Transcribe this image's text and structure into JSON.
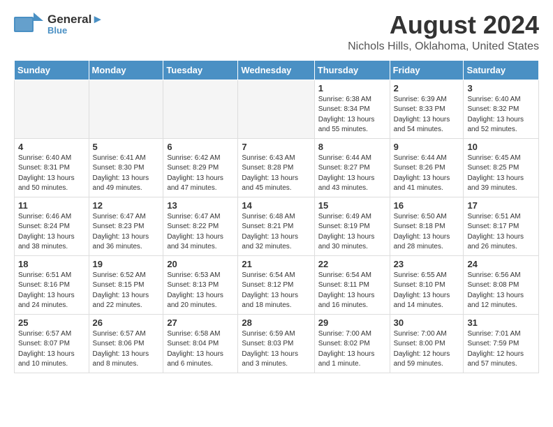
{
  "header": {
    "logo_general": "General",
    "logo_blue": "Blue",
    "month_title": "August 2024",
    "location": "Nichols Hills, Oklahoma, United States"
  },
  "weekdays": [
    "Sunday",
    "Monday",
    "Tuesday",
    "Wednesday",
    "Thursday",
    "Friday",
    "Saturday"
  ],
  "weeks": [
    [
      {
        "day": "",
        "sunrise": "",
        "sunset": "",
        "daylight": ""
      },
      {
        "day": "",
        "sunrise": "",
        "sunset": "",
        "daylight": ""
      },
      {
        "day": "",
        "sunrise": "",
        "sunset": "",
        "daylight": ""
      },
      {
        "day": "",
        "sunrise": "",
        "sunset": "",
        "daylight": ""
      },
      {
        "day": "1",
        "sunrise": "Sunrise: 6:38 AM",
        "sunset": "Sunset: 8:34 PM",
        "daylight": "Daylight: 13 hours and 55 minutes."
      },
      {
        "day": "2",
        "sunrise": "Sunrise: 6:39 AM",
        "sunset": "Sunset: 8:33 PM",
        "daylight": "Daylight: 13 hours and 54 minutes."
      },
      {
        "day": "3",
        "sunrise": "Sunrise: 6:40 AM",
        "sunset": "Sunset: 8:32 PM",
        "daylight": "Daylight: 13 hours and 52 minutes."
      }
    ],
    [
      {
        "day": "4",
        "sunrise": "Sunrise: 6:40 AM",
        "sunset": "Sunset: 8:31 PM",
        "daylight": "Daylight: 13 hours and 50 minutes."
      },
      {
        "day": "5",
        "sunrise": "Sunrise: 6:41 AM",
        "sunset": "Sunset: 8:30 PM",
        "daylight": "Daylight: 13 hours and 49 minutes."
      },
      {
        "day": "6",
        "sunrise": "Sunrise: 6:42 AM",
        "sunset": "Sunset: 8:29 PM",
        "daylight": "Daylight: 13 hours and 47 minutes."
      },
      {
        "day": "7",
        "sunrise": "Sunrise: 6:43 AM",
        "sunset": "Sunset: 8:28 PM",
        "daylight": "Daylight: 13 hours and 45 minutes."
      },
      {
        "day": "8",
        "sunrise": "Sunrise: 6:44 AM",
        "sunset": "Sunset: 8:27 PM",
        "daylight": "Daylight: 13 hours and 43 minutes."
      },
      {
        "day": "9",
        "sunrise": "Sunrise: 6:44 AM",
        "sunset": "Sunset: 8:26 PM",
        "daylight": "Daylight: 13 hours and 41 minutes."
      },
      {
        "day": "10",
        "sunrise": "Sunrise: 6:45 AM",
        "sunset": "Sunset: 8:25 PM",
        "daylight": "Daylight: 13 hours and 39 minutes."
      }
    ],
    [
      {
        "day": "11",
        "sunrise": "Sunrise: 6:46 AM",
        "sunset": "Sunset: 8:24 PM",
        "daylight": "Daylight: 13 hours and 38 minutes."
      },
      {
        "day": "12",
        "sunrise": "Sunrise: 6:47 AM",
        "sunset": "Sunset: 8:23 PM",
        "daylight": "Daylight: 13 hours and 36 minutes."
      },
      {
        "day": "13",
        "sunrise": "Sunrise: 6:47 AM",
        "sunset": "Sunset: 8:22 PM",
        "daylight": "Daylight: 13 hours and 34 minutes."
      },
      {
        "day": "14",
        "sunrise": "Sunrise: 6:48 AM",
        "sunset": "Sunset: 8:21 PM",
        "daylight": "Daylight: 13 hours and 32 minutes."
      },
      {
        "day": "15",
        "sunrise": "Sunrise: 6:49 AM",
        "sunset": "Sunset: 8:19 PM",
        "daylight": "Daylight: 13 hours and 30 minutes."
      },
      {
        "day": "16",
        "sunrise": "Sunrise: 6:50 AM",
        "sunset": "Sunset: 8:18 PM",
        "daylight": "Daylight: 13 hours and 28 minutes."
      },
      {
        "day": "17",
        "sunrise": "Sunrise: 6:51 AM",
        "sunset": "Sunset: 8:17 PM",
        "daylight": "Daylight: 13 hours and 26 minutes."
      }
    ],
    [
      {
        "day": "18",
        "sunrise": "Sunrise: 6:51 AM",
        "sunset": "Sunset: 8:16 PM",
        "daylight": "Daylight: 13 hours and 24 minutes."
      },
      {
        "day": "19",
        "sunrise": "Sunrise: 6:52 AM",
        "sunset": "Sunset: 8:15 PM",
        "daylight": "Daylight: 13 hours and 22 minutes."
      },
      {
        "day": "20",
        "sunrise": "Sunrise: 6:53 AM",
        "sunset": "Sunset: 8:13 PM",
        "daylight": "Daylight: 13 hours and 20 minutes."
      },
      {
        "day": "21",
        "sunrise": "Sunrise: 6:54 AM",
        "sunset": "Sunset: 8:12 PM",
        "daylight": "Daylight: 13 hours and 18 minutes."
      },
      {
        "day": "22",
        "sunrise": "Sunrise: 6:54 AM",
        "sunset": "Sunset: 8:11 PM",
        "daylight": "Daylight: 13 hours and 16 minutes."
      },
      {
        "day": "23",
        "sunrise": "Sunrise: 6:55 AM",
        "sunset": "Sunset: 8:10 PM",
        "daylight": "Daylight: 13 hours and 14 minutes."
      },
      {
        "day": "24",
        "sunrise": "Sunrise: 6:56 AM",
        "sunset": "Sunset: 8:08 PM",
        "daylight": "Daylight: 13 hours and 12 minutes."
      }
    ],
    [
      {
        "day": "25",
        "sunrise": "Sunrise: 6:57 AM",
        "sunset": "Sunset: 8:07 PM",
        "daylight": "Daylight: 13 hours and 10 minutes."
      },
      {
        "day": "26",
        "sunrise": "Sunrise: 6:57 AM",
        "sunset": "Sunset: 8:06 PM",
        "daylight": "Daylight: 13 hours and 8 minutes."
      },
      {
        "day": "27",
        "sunrise": "Sunrise: 6:58 AM",
        "sunset": "Sunset: 8:04 PM",
        "daylight": "Daylight: 13 hours and 6 minutes."
      },
      {
        "day": "28",
        "sunrise": "Sunrise: 6:59 AM",
        "sunset": "Sunset: 8:03 PM",
        "daylight": "Daylight: 13 hours and 3 minutes."
      },
      {
        "day": "29",
        "sunrise": "Sunrise: 7:00 AM",
        "sunset": "Sunset: 8:02 PM",
        "daylight": "Daylight: 13 hours and 1 minute."
      },
      {
        "day": "30",
        "sunrise": "Sunrise: 7:00 AM",
        "sunset": "Sunset: 8:00 PM",
        "daylight": "Daylight: 12 hours and 59 minutes."
      },
      {
        "day": "31",
        "sunrise": "Sunrise: 7:01 AM",
        "sunset": "Sunset: 7:59 PM",
        "daylight": "Daylight: 12 hours and 57 minutes."
      }
    ]
  ]
}
